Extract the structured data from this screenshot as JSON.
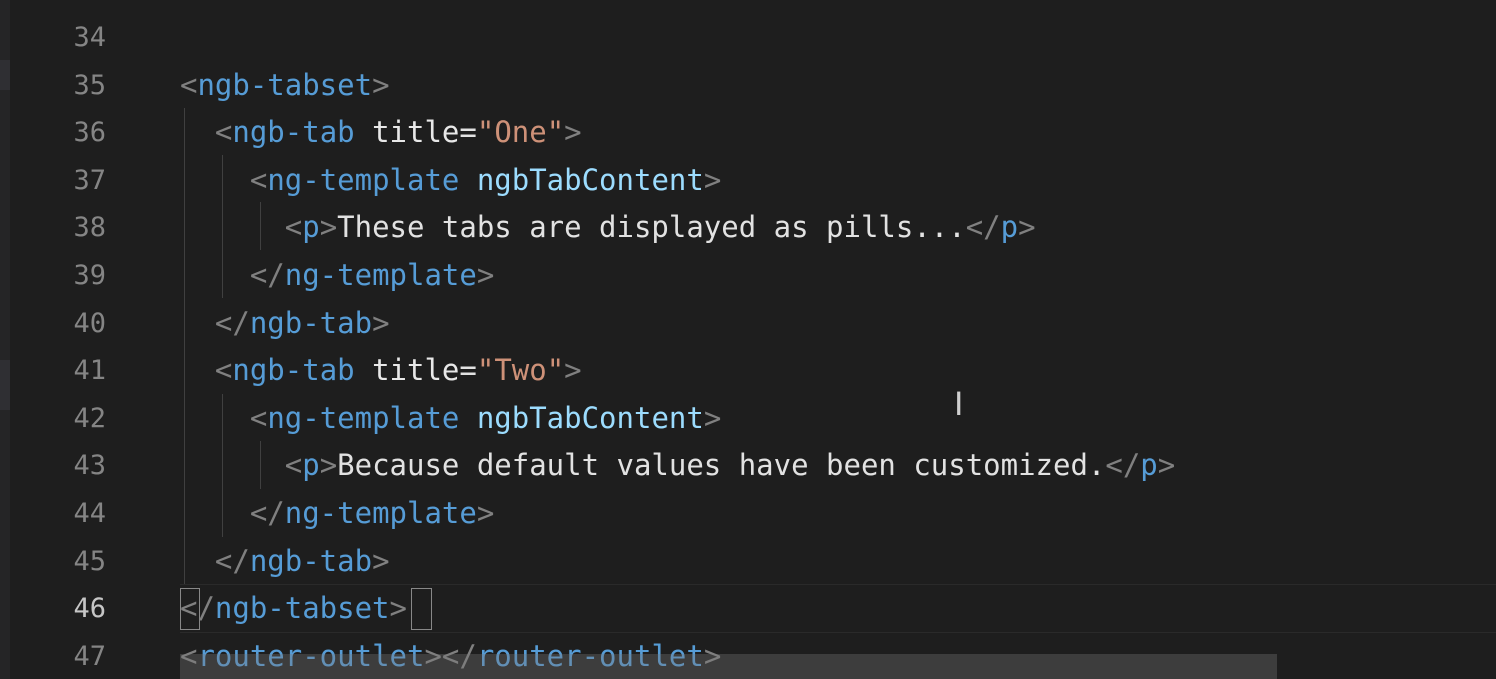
{
  "editor": {
    "language": "html",
    "cursor_icon": "text-cursor-icon",
    "lines": [
      {
        "number": "34",
        "segments": []
      },
      {
        "number": "35",
        "segments": [
          {
            "t": "<",
            "c": "tag-bracket"
          },
          {
            "t": "ngb-tabset",
            "c": "tag-name"
          },
          {
            "t": ">",
            "c": "tag-bracket"
          }
        ]
      },
      {
        "number": "36",
        "segments": [
          {
            "t": "  <",
            "c": "tag-bracket"
          },
          {
            "t": "ngb-tab",
            "c": "tag-name"
          },
          {
            "t": " ",
            "c": "text"
          },
          {
            "t": "title",
            "c": "attr-plain"
          },
          {
            "t": "=",
            "c": "text"
          },
          {
            "t": "\"One\"",
            "c": "str"
          },
          {
            "t": ">",
            "c": "tag-bracket"
          }
        ]
      },
      {
        "number": "37",
        "segments": [
          {
            "t": "    <",
            "c": "tag-bracket"
          },
          {
            "t": "ng-template",
            "c": "tag-name"
          },
          {
            "t": " ",
            "c": "text"
          },
          {
            "t": "ngbTabContent",
            "c": "attr"
          },
          {
            "t": ">",
            "c": "tag-bracket"
          }
        ]
      },
      {
        "number": "38",
        "segments": [
          {
            "t": "      <",
            "c": "tag-bracket"
          },
          {
            "t": "p",
            "c": "tag-name"
          },
          {
            "t": ">",
            "c": "tag-bracket"
          },
          {
            "t": "These tabs are displayed as pills...",
            "c": "text"
          },
          {
            "t": "</",
            "c": "tag-bracket"
          },
          {
            "t": "p",
            "c": "tag-name"
          },
          {
            "t": ">",
            "c": "tag-bracket"
          }
        ]
      },
      {
        "number": "39",
        "segments": [
          {
            "t": "    </",
            "c": "tag-bracket"
          },
          {
            "t": "ng-template",
            "c": "tag-name"
          },
          {
            "t": ">",
            "c": "tag-bracket"
          }
        ]
      },
      {
        "number": "40",
        "segments": [
          {
            "t": "  </",
            "c": "tag-bracket"
          },
          {
            "t": "ngb-tab",
            "c": "tag-name"
          },
          {
            "t": ">",
            "c": "tag-bracket"
          }
        ]
      },
      {
        "number": "41",
        "segments": [
          {
            "t": "  <",
            "c": "tag-bracket"
          },
          {
            "t": "ngb-tab",
            "c": "tag-name"
          },
          {
            "t": " ",
            "c": "text"
          },
          {
            "t": "title",
            "c": "attr-plain"
          },
          {
            "t": "=",
            "c": "text"
          },
          {
            "t": "\"Two\"",
            "c": "str"
          },
          {
            "t": ">",
            "c": "tag-bracket"
          }
        ]
      },
      {
        "number": "42",
        "segments": [
          {
            "t": "    <",
            "c": "tag-bracket"
          },
          {
            "t": "ng-template",
            "c": "tag-name"
          },
          {
            "t": " ",
            "c": "text"
          },
          {
            "t": "ngbTabContent",
            "c": "attr"
          },
          {
            "t": ">",
            "c": "tag-bracket"
          }
        ]
      },
      {
        "number": "43",
        "segments": [
          {
            "t": "      <",
            "c": "tag-bracket"
          },
          {
            "t": "p",
            "c": "tag-name"
          },
          {
            "t": ">",
            "c": "tag-bracket"
          },
          {
            "t": "Because default values have been customized.",
            "c": "text"
          },
          {
            "t": "</",
            "c": "tag-bracket"
          },
          {
            "t": "p",
            "c": "tag-name"
          },
          {
            "t": ">",
            "c": "tag-bracket"
          }
        ]
      },
      {
        "number": "44",
        "segments": [
          {
            "t": "    </",
            "c": "tag-bracket"
          },
          {
            "t": "ng-template",
            "c": "tag-name"
          },
          {
            "t": ">",
            "c": "tag-bracket"
          }
        ]
      },
      {
        "number": "45",
        "segments": [
          {
            "t": "  </",
            "c": "tag-bracket"
          },
          {
            "t": "ngb-tab",
            "c": "tag-name"
          },
          {
            "t": ">",
            "c": "tag-bracket"
          }
        ]
      },
      {
        "number": "46",
        "active": true,
        "segments": [
          {
            "t": "</",
            "c": "tag-bracket"
          },
          {
            "t": "ngb-tabset",
            "c": "tag-name"
          },
          {
            "t": ">",
            "c": "tag-bracket"
          }
        ]
      },
      {
        "number": "47",
        "segments": [
          {
            "t": "<",
            "c": "tag-bracket"
          },
          {
            "t": "router-outlet",
            "c": "tag-name"
          },
          {
            "t": "></",
            "c": "tag-bracket"
          },
          {
            "t": "router-outlet",
            "c": "tag-name"
          },
          {
            "t": ">",
            "c": "tag-bracket"
          }
        ]
      }
    ],
    "colors": {
      "background": "#1e1e1e",
      "tag_name": "#569cd6",
      "attribute": "#9cdcfe",
      "string": "#ce9178",
      "text": "#d4d4d4",
      "line_number": "#858585"
    }
  }
}
